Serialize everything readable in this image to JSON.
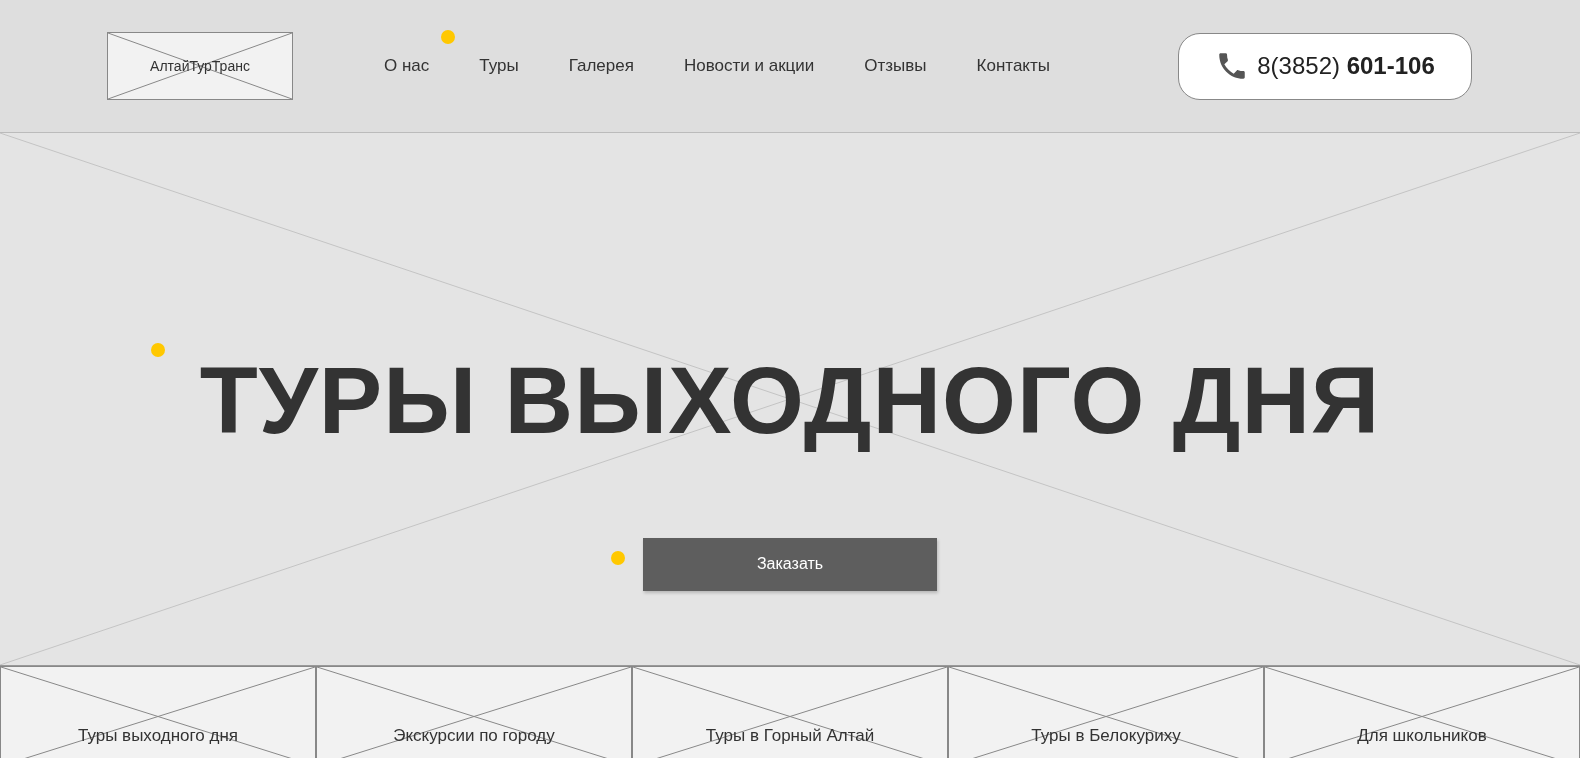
{
  "header": {
    "logo": "АлтайТурТранс",
    "nav": [
      {
        "label": "О нас"
      },
      {
        "label": "Туры"
      },
      {
        "label": "Галерея"
      },
      {
        "label": "Новости и акции"
      },
      {
        "label": "Отзывы"
      },
      {
        "label": "Контакты"
      }
    ],
    "phone": "8(3852) **601-106**"
  },
  "hero": {
    "title": "ТУРЫ ВЫХОДНОГО ДНЯ",
    "button": "Заказать"
  },
  "categories": [
    {
      "label": "Туры выходного дня"
    },
    {
      "label": "Экскурсии по городу"
    },
    {
      "label": "Туры в Горный Алтай"
    },
    {
      "label": "Туры в Белокуриху"
    },
    {
      "label": "Для школьников"
    }
  ]
}
